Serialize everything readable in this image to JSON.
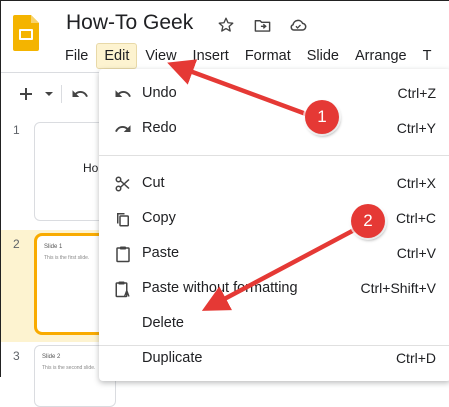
{
  "app": {
    "title": "How-To Geek",
    "icons": [
      "star-icon",
      "move-to-folder-icon",
      "cloud-saved-icon"
    ]
  },
  "menubar": {
    "items": [
      "File",
      "Edit",
      "View",
      "Insert",
      "Format",
      "Slide",
      "Arrange",
      "T"
    ],
    "active": "Edit"
  },
  "toolbar": {
    "icons": [
      "plus-icon",
      "dropdown-caret-icon",
      "undo-icon"
    ]
  },
  "slides": [
    {
      "number": "1",
      "big_text": "Ho",
      "title": "",
      "body": ""
    },
    {
      "number": "2",
      "big_text": "",
      "title": "Slide 1",
      "body": "This is the first slide."
    },
    {
      "number": "3",
      "big_text": "",
      "title": "Slide 2",
      "body": "This is the second slide."
    }
  ],
  "edit_menu": {
    "items": [
      {
        "label": "Undo",
        "shortcut": "Ctrl+Z",
        "icon": "undo-icon"
      },
      {
        "label": "Redo",
        "shortcut": "Ctrl+Y",
        "icon": "redo-icon"
      },
      {
        "label": "Cut",
        "shortcut": "Ctrl+X",
        "icon": "scissors-icon"
      },
      {
        "label": "Copy",
        "shortcut": "Ctrl+C",
        "icon": "copy-icon"
      },
      {
        "label": "Paste",
        "shortcut": "Ctrl+V",
        "icon": "clipboard-icon"
      },
      {
        "label": "Paste without formatting",
        "shortcut": "Ctrl+Shift+V",
        "icon": "paste-text-icon"
      },
      {
        "label": "Delete",
        "shortcut": "",
        "icon": ""
      },
      {
        "label": "Duplicate",
        "shortcut": "Ctrl+D",
        "icon": ""
      }
    ]
  },
  "annotations": {
    "badge1": "1",
    "badge2": "2",
    "arrow_color": "#e53935"
  },
  "colors": {
    "logo_yellow": "#f4b400",
    "selected_border": "#f9ab00",
    "active_menu_bg": "#fdf3d0"
  }
}
